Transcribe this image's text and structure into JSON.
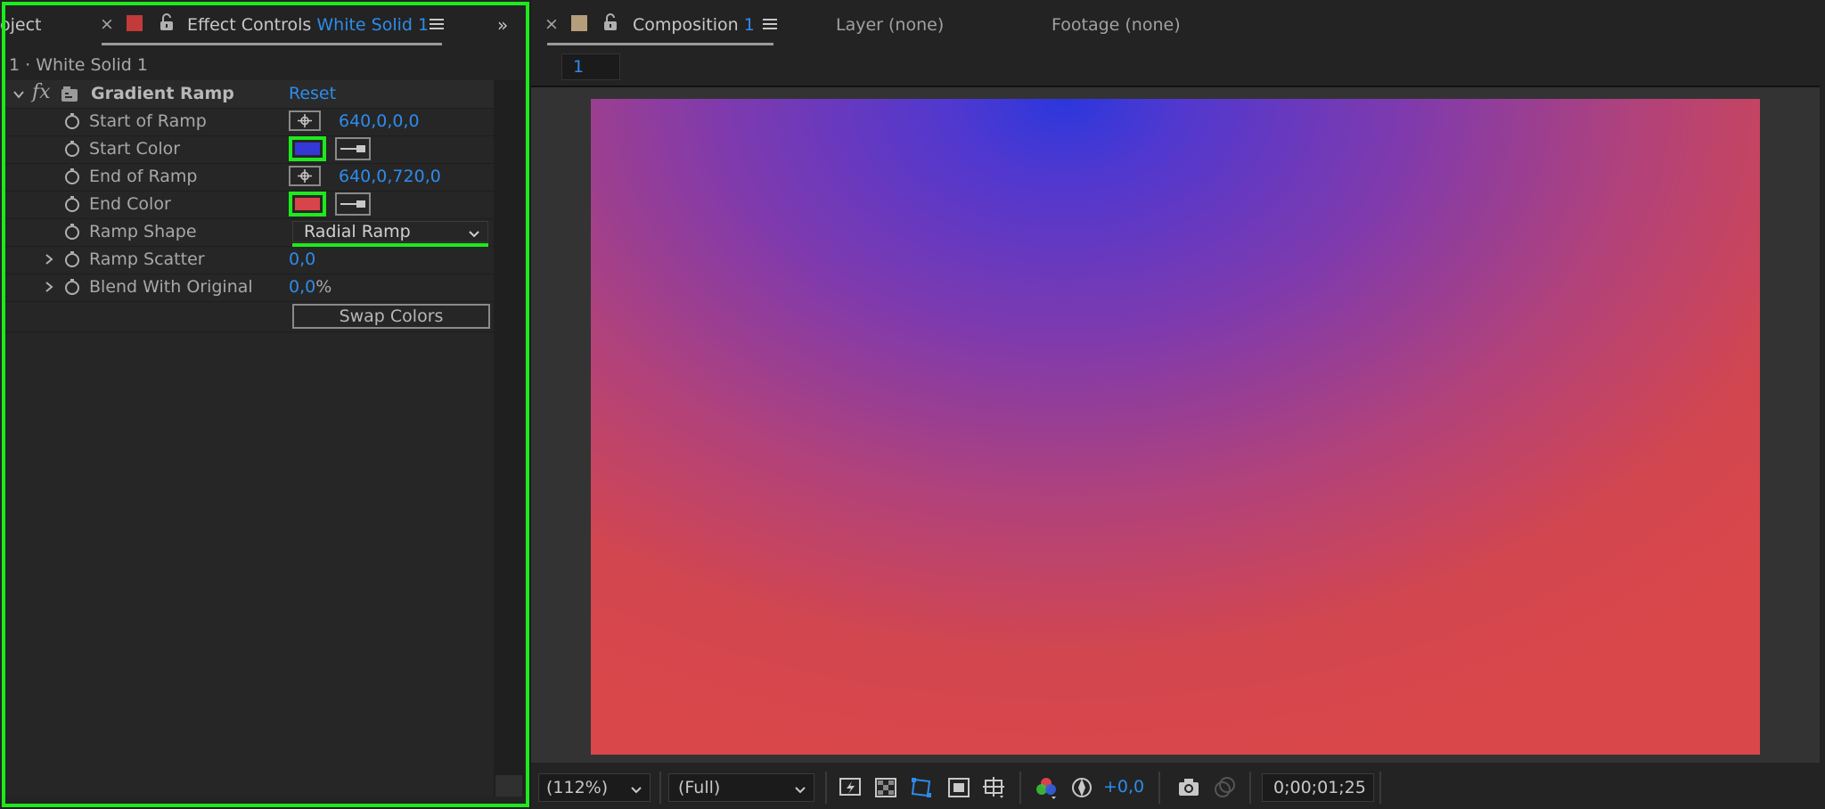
{
  "left_panel": {
    "tabs": {
      "project_partial": "oject",
      "effect_controls_prefix": "Effect Controls",
      "effect_controls_layer": "White Solid 1"
    },
    "subtitle": "1 · White Solid 1",
    "effect": {
      "fx_label": "fx",
      "name": "Gradient Ramp",
      "reset_label": "Reset",
      "properties": [
        {
          "label": "Start of Ramp",
          "value": "640,0,0,0"
        },
        {
          "label": "Start Color",
          "color": "#3338d6"
        },
        {
          "label": "End of Ramp",
          "value": "640,0,720,0"
        },
        {
          "label": "End Color",
          "color": "#d9434a"
        },
        {
          "label": "Ramp Shape",
          "value": "Radial Ramp"
        },
        {
          "label": "Ramp Scatter",
          "value": "0,0"
        },
        {
          "label": "Blend With Original",
          "value_num": "0,0",
          "value_unit": "%"
        }
      ],
      "swap_colors_label": "Swap Colors"
    }
  },
  "right_panel": {
    "tabs": {
      "composition_prefix": "Composition",
      "composition_num": "1",
      "layer": "Layer (none)",
      "footage": "Footage (none)"
    },
    "breadcrumb": "1",
    "bottom_bar": {
      "zoom": "(112%)",
      "resolution": "(Full)",
      "exposure": "+0,0",
      "timecode": "0;00;01;25"
    }
  },
  "colors": {
    "highlight": "#1ee91e",
    "accent_blue": "#2d8ceb",
    "label_red": "#c23a3a",
    "label_tan": "#b59f7b"
  }
}
